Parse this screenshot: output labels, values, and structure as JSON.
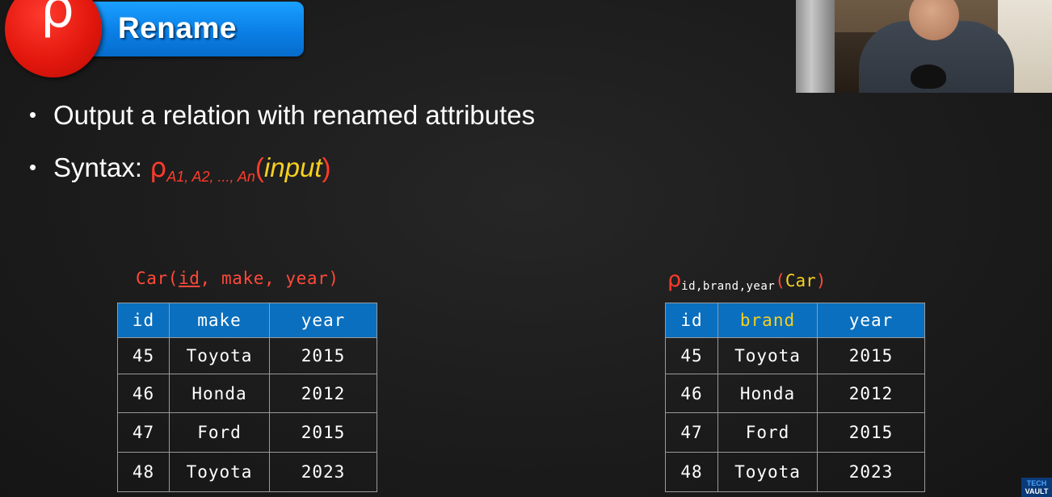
{
  "slide": {
    "title": "Rename",
    "title_symbol": "ρ",
    "bullets": [
      "Output a relation with renamed attributes",
      "Syntax: "
    ],
    "syntax": {
      "operator": "ρ",
      "subscript": "A1, A2, ..., An",
      "open_paren": "(",
      "argument": "input",
      "close_paren": ")"
    }
  },
  "left_table": {
    "caption_prefix": "Car(",
    "caption_key": "id",
    "caption_rest": ", make, year)",
    "headers": [
      "id",
      "make",
      "year"
    ],
    "rows": [
      [
        "45",
        "Toyota",
        "2015"
      ],
      [
        "46",
        "Honda",
        "2012"
      ],
      [
        "47",
        "Ford",
        "2015"
      ],
      [
        "48",
        "Toyota",
        "2023"
      ]
    ]
  },
  "right_table": {
    "caption_operator": "ρ",
    "caption_subscript": "id,brand,year",
    "caption_open": "(",
    "caption_relation": "Car",
    "caption_close": ")",
    "headers": [
      "id",
      "brand",
      "year"
    ],
    "rows": [
      [
        "45",
        "Toyota",
        "2015"
      ],
      [
        "46",
        "Honda",
        "2012"
      ],
      [
        "47",
        "Ford",
        "2015"
      ],
      [
        "48",
        "Toyota",
        "2023"
      ]
    ]
  },
  "watermark": {
    "line1": "TECH",
    "line2": "VAULT"
  },
  "colors": {
    "accent_red": "#ff3b2b",
    "accent_yellow": "#f5d020",
    "header_blue": "#0a6fbe",
    "title_blue": "#0b7fe6"
  }
}
